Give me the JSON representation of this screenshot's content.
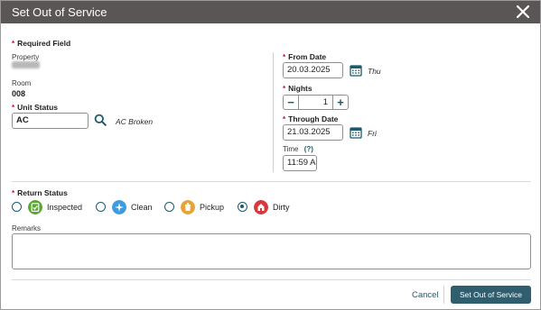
{
  "dialog": {
    "title": "Set Out of Service",
    "close_icon": "close-icon"
  },
  "required_note": {
    "asterisk": "*",
    "text": "Required Field"
  },
  "property": {
    "label": "Property",
    "value_obscured": true
  },
  "room": {
    "label": "Room",
    "value": "008"
  },
  "unit_status": {
    "asterisk": "*",
    "label": "Unit Status",
    "value": "AC",
    "search_icon": "search-icon",
    "description": "AC Broken"
  },
  "from_date": {
    "asterisk": "*",
    "label": "From Date",
    "value": "20.03.2025",
    "calendar_icon": "calendar-icon",
    "weekday": "Thu"
  },
  "nights": {
    "asterisk": "*",
    "label": "Nights",
    "minus": "−",
    "value": "1",
    "plus": "+"
  },
  "through_date": {
    "asterisk": "*",
    "label": "Through Date",
    "value": "21.03.2025",
    "calendar_icon": "calendar-icon",
    "weekday": "Fri"
  },
  "time": {
    "label": "Time",
    "help": "(?)",
    "value": "11:59 A"
  },
  "return_status": {
    "asterisk": "*",
    "label": "Return Status",
    "options": [
      {
        "label": "Inspected",
        "icon": "inspected-icon",
        "color": "#5aa832",
        "checked": false
      },
      {
        "label": "Clean",
        "icon": "clean-icon",
        "color": "#3d9be0",
        "checked": false
      },
      {
        "label": "Pickup",
        "icon": "pickup-icon",
        "color": "#e8a338",
        "checked": false
      },
      {
        "label": "Dirty",
        "icon": "dirty-icon",
        "color": "#d8383a",
        "checked": true
      }
    ]
  },
  "remarks": {
    "label": "Remarks",
    "value": ""
  },
  "footer": {
    "cancel_label": "Cancel",
    "submit_label": "Set Out of Service"
  },
  "colors": {
    "titlebar": "#5a5656",
    "accent": "#1b5b6d",
    "primary_button": "#2f5e6f",
    "required": "#c8102e"
  }
}
